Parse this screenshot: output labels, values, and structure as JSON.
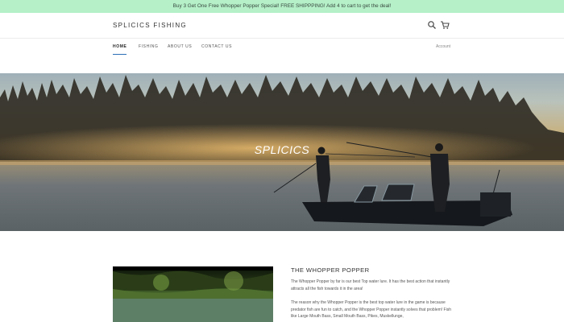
{
  "announcement": "Buy 3 Get One Free Whopper Popper Special! FREE SHIPPPING! Add 4 to cart to get the deal!",
  "header": {
    "logo": "SPLICICS FISHING",
    "icons": [
      "search-icon",
      "cart-icon"
    ]
  },
  "nav": {
    "items": [
      {
        "label": "HOME"
      },
      {
        "label": "FISHING"
      },
      {
        "label": "ABOUT US"
      },
      {
        "label": "CONTACT US"
      }
    ],
    "active": "HOME",
    "account_label": "Account"
  },
  "hero": {
    "title": "SPLICICS"
  },
  "feature": {
    "title": "THE WHOPPER POPPER",
    "paragraph1": "The Whopper Popper by far is our best Top water lure. It has the best action that instantly attracts all the fish towards it in the area!",
    "paragraph2": "The reason why the Whopper Popper is the best top water lure in the game is because predator fish are fun to catch, and the Whopper Popper instantly solves that problem! Fish like Large Mouth Bass, Small Mouth Bass, Pikes, Muskellunge,"
  },
  "colors": {
    "announcement_bg": "#b5f0c8",
    "nav_active_underline": "#2a6fb5"
  }
}
